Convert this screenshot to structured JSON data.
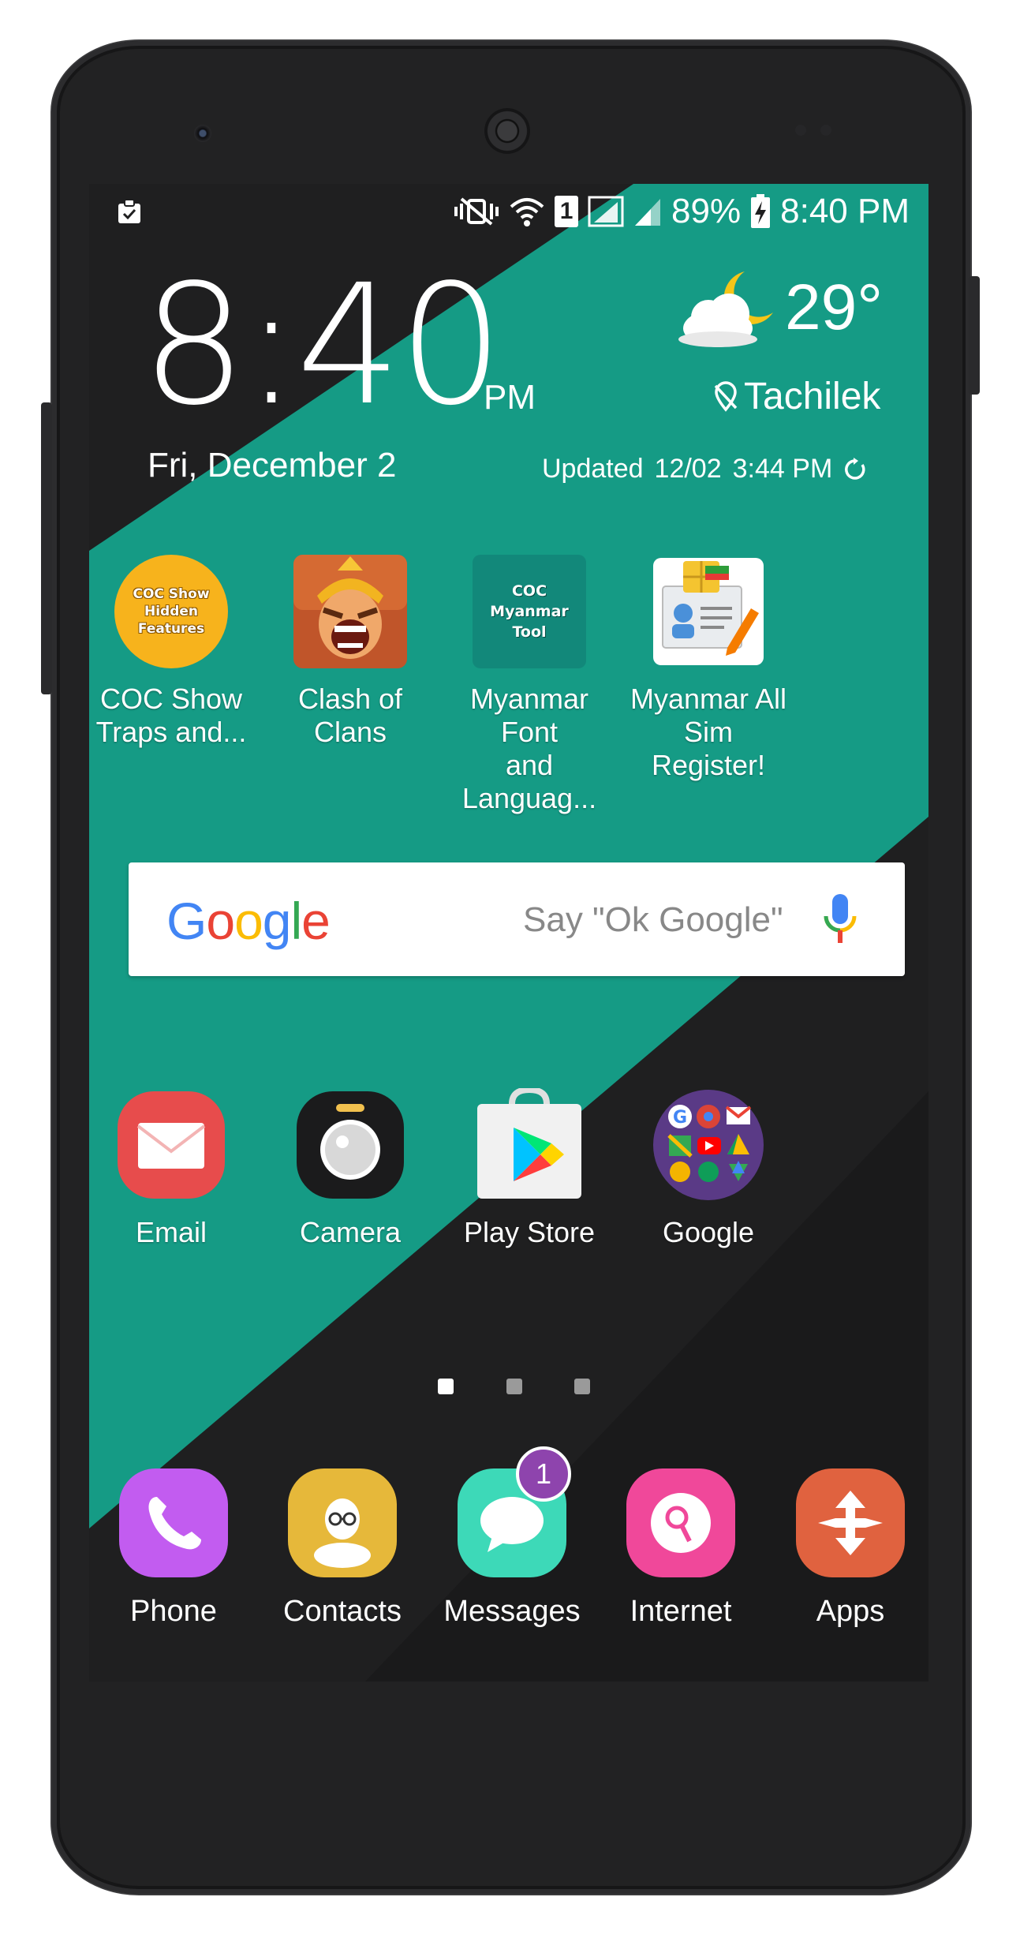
{
  "status_bar": {
    "battery_percent": "89%",
    "time": "8:40 PM",
    "sim_slot": "1",
    "icons": [
      "clipboard-icon",
      "vibrate-mute-icon",
      "wifi-icon",
      "sim1-icon",
      "signal-icon",
      "signal-icon-2",
      "charging-battery-icon"
    ]
  },
  "clock_widget": {
    "time": "8:40",
    "ampm": "PM",
    "date": "Fri, December 2",
    "temperature": "29°",
    "location": "Tachilek",
    "updated_label": "Updated",
    "updated_date": "12/02",
    "updated_time": "3:44 PM",
    "weather_icon": "partly-cloudy-night-icon"
  },
  "apps_row1": [
    {
      "label": "COC Show\nTraps and...",
      "icon_text": "COC Show\nHidden\nFeatures"
    },
    {
      "label": "Clash of Clans"
    },
    {
      "label": "Myanmar Font\nand Languag...",
      "icon_text": "COC\nMyanmar\nTool"
    },
    {
      "label": "Myanmar All\nSim Register!"
    }
  ],
  "search": {
    "logo": "Google",
    "hint": "Say \"Ok Google\""
  },
  "apps_row2": [
    {
      "label": "Email"
    },
    {
      "label": "Camera"
    },
    {
      "label": "Play Store"
    },
    {
      "label": "Google"
    }
  ],
  "page_indicator": {
    "pages": 3,
    "current": 1
  },
  "dock": [
    {
      "label": "Phone"
    },
    {
      "label": "Contacts"
    },
    {
      "label": "Messages",
      "badge": "1"
    },
    {
      "label": "Internet"
    },
    {
      "label": "Apps"
    }
  ],
  "colors": {
    "teal": "#159b85",
    "dark": "#1f1f20",
    "phone_body": "#222223"
  }
}
